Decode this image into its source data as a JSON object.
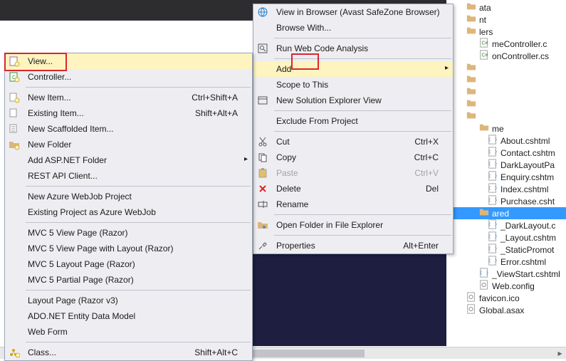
{
  "topbar": {},
  "explorer": {
    "items": [
      {
        "label": "ata",
        "indent": 1,
        "icon": "folder"
      },
      {
        "label": "nt",
        "indent": 1,
        "icon": "folder"
      },
      {
        "label": "lers",
        "indent": 1,
        "icon": "folder"
      },
      {
        "label": "meController.c",
        "indent": 2,
        "icon": "cs"
      },
      {
        "label": "onController.cs",
        "indent": 2,
        "icon": "cs"
      },
      {
        "label": "",
        "indent": 1,
        "icon": "folder"
      },
      {
        "label": "",
        "indent": 1,
        "icon": "folder"
      },
      {
        "label": "",
        "indent": 1,
        "icon": "folder"
      },
      {
        "label": "",
        "indent": 1,
        "icon": "folder"
      },
      {
        "label": "",
        "indent": 1,
        "icon": "folder"
      },
      {
        "label": "me",
        "indent": 2,
        "icon": "folder"
      },
      {
        "label": "About.cshtml",
        "indent": 3,
        "icon": "html"
      },
      {
        "label": "Contact.cshtm",
        "indent": 3,
        "icon": "html"
      },
      {
        "label": "DarkLayoutPa",
        "indent": 3,
        "icon": "html"
      },
      {
        "label": "Enquiry.cshtm",
        "indent": 3,
        "icon": "html"
      },
      {
        "label": "Index.cshtml",
        "indent": 3,
        "icon": "html"
      },
      {
        "label": "Purchase.csht",
        "indent": 3,
        "icon": "html"
      },
      {
        "label": "ared",
        "indent": 2,
        "icon": "folder",
        "sel": true
      },
      {
        "label": "_DarkLayout.c",
        "indent": 3,
        "icon": "html"
      },
      {
        "label": "_Layout.cshtm",
        "indent": 3,
        "icon": "html"
      },
      {
        "label": "_StaticPromot",
        "indent": 3,
        "icon": "html"
      },
      {
        "label": "Error.cshtml",
        "indent": 3,
        "icon": "html"
      },
      {
        "label": "_ViewStart.cshtml",
        "indent": 2,
        "icon": "html"
      },
      {
        "label": "Web.config",
        "indent": 2,
        "icon": "config"
      },
      {
        "label": "favicon.ico",
        "indent": 1,
        "icon": "config"
      },
      {
        "label": "Global.asax",
        "indent": 1,
        "icon": "config"
      }
    ]
  },
  "menu1": {
    "groups": [
      [
        {
          "label": "View...",
          "icon": "view",
          "hl": true
        },
        {
          "label": "Controller...",
          "icon": "controller"
        }
      ],
      [
        {
          "label": "New Item...",
          "icon": "newitem",
          "shortcut": "Ctrl+Shift+A"
        },
        {
          "label": "Existing Item...",
          "icon": "existitem",
          "shortcut": "Shift+Alt+A"
        },
        {
          "label": "New Scaffolded Item...",
          "icon": "scaffold"
        },
        {
          "label": "New Folder",
          "icon": "newfolder"
        },
        {
          "label": "Add ASP.NET Folder",
          "submenu": true
        },
        {
          "label": "REST API Client..."
        }
      ],
      [
        {
          "label": "New Azure WebJob Project"
        },
        {
          "label": "Existing Project as Azure WebJob"
        }
      ],
      [
        {
          "label": "MVC 5 View Page (Razor)"
        },
        {
          "label": "MVC 5 View Page with Layout (Razor)"
        },
        {
          "label": "MVC 5 Layout Page (Razor)"
        },
        {
          "label": "MVC 5 Partial Page (Razor)"
        }
      ],
      [
        {
          "label": "Layout Page (Razor v3)"
        },
        {
          "label": "ADO.NET Entity Data Model"
        },
        {
          "label": "Web Form"
        }
      ],
      [
        {
          "label": "Class...",
          "icon": "class",
          "shortcut": "Shift+Alt+C"
        }
      ]
    ]
  },
  "menu2": {
    "groups": [
      [
        {
          "label": "View in Browser (Avast SafeZone Browser)",
          "icon": "browser"
        },
        {
          "label": "Browse With..."
        }
      ],
      [
        {
          "label": "Run Web Code Analysis",
          "icon": "analysis"
        }
      ],
      [
        {
          "label": "Add",
          "hl": true,
          "submenu": true
        },
        {
          "label": "Scope to This"
        },
        {
          "label": "New Solution Explorer View",
          "icon": "solution"
        }
      ],
      [
        {
          "label": "Exclude From Project"
        }
      ],
      [
        {
          "label": "Cut",
          "icon": "cut",
          "shortcut": "Ctrl+X"
        },
        {
          "label": "Copy",
          "icon": "copy",
          "shortcut": "Ctrl+C"
        },
        {
          "label": "Paste",
          "icon": "paste",
          "shortcut": "Ctrl+V",
          "disabled": true
        },
        {
          "label": "Delete",
          "icon": "delete",
          "shortcut": "Del"
        },
        {
          "label": "Rename",
          "icon": "rename"
        }
      ],
      [
        {
          "label": "Open Folder in File Explorer",
          "icon": "openfolder"
        }
      ],
      [
        {
          "label": "Properties",
          "icon": "properties",
          "shortcut": "Alt+Enter"
        }
      ]
    ]
  }
}
